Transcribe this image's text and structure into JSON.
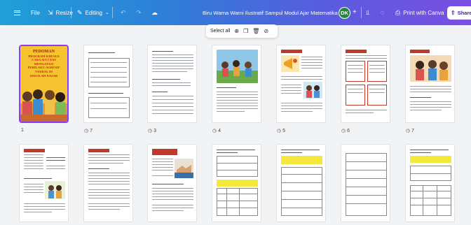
{
  "topbar": {
    "file_label": "File",
    "resize_label": "Resize",
    "editing_label": "Editing",
    "doc_title": "Biru Warna Warni Ilustratif Sampul Modul Ajar Matematika ...",
    "avatar_initials": "DK",
    "print_label": "Print with Canva",
    "share_label": "Share"
  },
  "selection_toolbar": {
    "select_all_label": "Select all"
  },
  "cover": {
    "heading": "PEDOMAN",
    "line1": "PROGRAM KHUSUS",
    "line2": "CARA SUCCESS MENGATASI",
    "line3": "PERILAKU AGRESIF VERBAL DI",
    "line4": "SEKOLAH DASAR"
  },
  "pages": [
    {
      "number": "1",
      "row": 1
    },
    {
      "number": "7",
      "row": 1
    },
    {
      "number": "3",
      "row": 1
    },
    {
      "number": "4",
      "row": 1
    },
    {
      "number": "5",
      "row": 1
    },
    {
      "number": "6",
      "row": 1
    },
    {
      "number": "7",
      "row": 1
    }
  ],
  "colors": {
    "topbar_start": "#1fa0d8",
    "topbar_end": "#7a4fe2",
    "selected_border": "#8b3dff",
    "accent_red": "#c0392b",
    "cover_yellow": "#f6c431"
  }
}
